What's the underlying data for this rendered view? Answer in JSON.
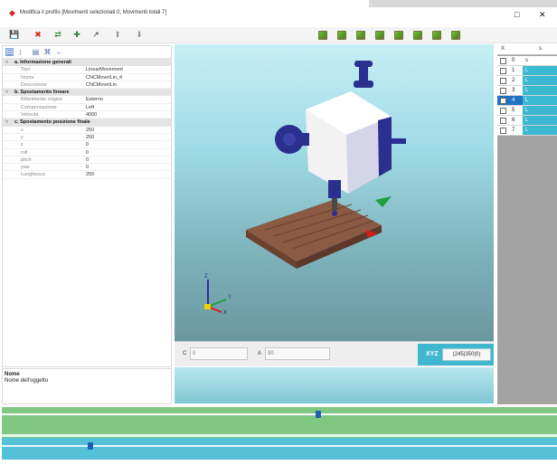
{
  "window": {
    "title": "Modifica il profilo [Movimenti selezionati 0; Movimenti totali 7]",
    "minimize_glyph": "□",
    "close_glyph": "✕"
  },
  "toolbar": {
    "icons": [
      "save-icon",
      "delete-icon",
      "move-icon",
      "add-icon",
      "path-icon",
      "up-icon",
      "down-icon"
    ],
    "glyphs": {
      "save": "💾",
      "delete": "✖",
      "move": "⇄",
      "add": "✚",
      "path": "↗",
      "up": "⬆",
      "down": "⬇"
    },
    "view_cube_count": 8
  },
  "properties": {
    "toolbar_glyphs": [
      "☰",
      "↕",
      "▤",
      "⌘",
      "←"
    ],
    "categories": [
      {
        "label": "a. Informazione generali",
        "rows": [
          {
            "key": "Tipo",
            "value": "LinearMovement"
          },
          {
            "key": "Nome",
            "value": "CNCMovelLin_4"
          },
          {
            "key": "Descrizione",
            "value": "CNCMovelLin"
          }
        ]
      },
      {
        "label": "b. Spostamento lineare",
        "rows": [
          {
            "key": "Riferimento origine",
            "value": "Esterno"
          },
          {
            "key": "Compensazione",
            "value": "Left"
          },
          {
            "key": "Velocità",
            "value": "4000"
          }
        ]
      },
      {
        "label": "c. Spostamento posizione finale",
        "rows": [
          {
            "key": "x",
            "value": "250"
          },
          {
            "key": "y",
            "value": "250"
          },
          {
            "key": "z",
            "value": "0"
          },
          {
            "key": "roll",
            "value": "0"
          },
          {
            "key": "pitch",
            "value": "0"
          },
          {
            "key": "yaw",
            "value": "0"
          },
          {
            "key": "Lunghezza",
            "value": "255"
          }
        ]
      }
    ],
    "description": {
      "title": "Nome",
      "text": "Nome dell'oggetto"
    }
  },
  "viewport": {
    "c_label": "C",
    "c_value": "0",
    "a_label": "A",
    "a_value": "90",
    "plane_label": "XYZ",
    "plane_value": "(245|350|0)",
    "axes": {
      "x": "X",
      "y": "Y",
      "z": "Z"
    }
  },
  "movement_list": {
    "headers": [
      "X",
      "s"
    ],
    "rows": [
      {
        "num": "0",
        "tag": "s",
        "selected": false
      },
      {
        "num": "1",
        "tag": "L",
        "selected": false
      },
      {
        "num": "2",
        "tag": "L",
        "selected": false
      },
      {
        "num": "3",
        "tag": "L",
        "selected": false
      },
      {
        "num": "4",
        "tag": "L",
        "selected": true
      },
      {
        "num": "5",
        "tag": "L",
        "selected": false
      },
      {
        "num": "6",
        "tag": "L",
        "selected": false
      },
      {
        "num": "7",
        "tag": "L",
        "selected": false
      }
    ]
  },
  "timeline": {
    "green_track_position": 0.57,
    "blue_track_position": 0.16
  },
  "colors": {
    "accent_red": "#d9261c",
    "selection_blue": "#1f72c4",
    "tag_cyan": "#3bb9d0",
    "timeline_green": "#80c882",
    "timeline_blue": "#55c1d8"
  }
}
